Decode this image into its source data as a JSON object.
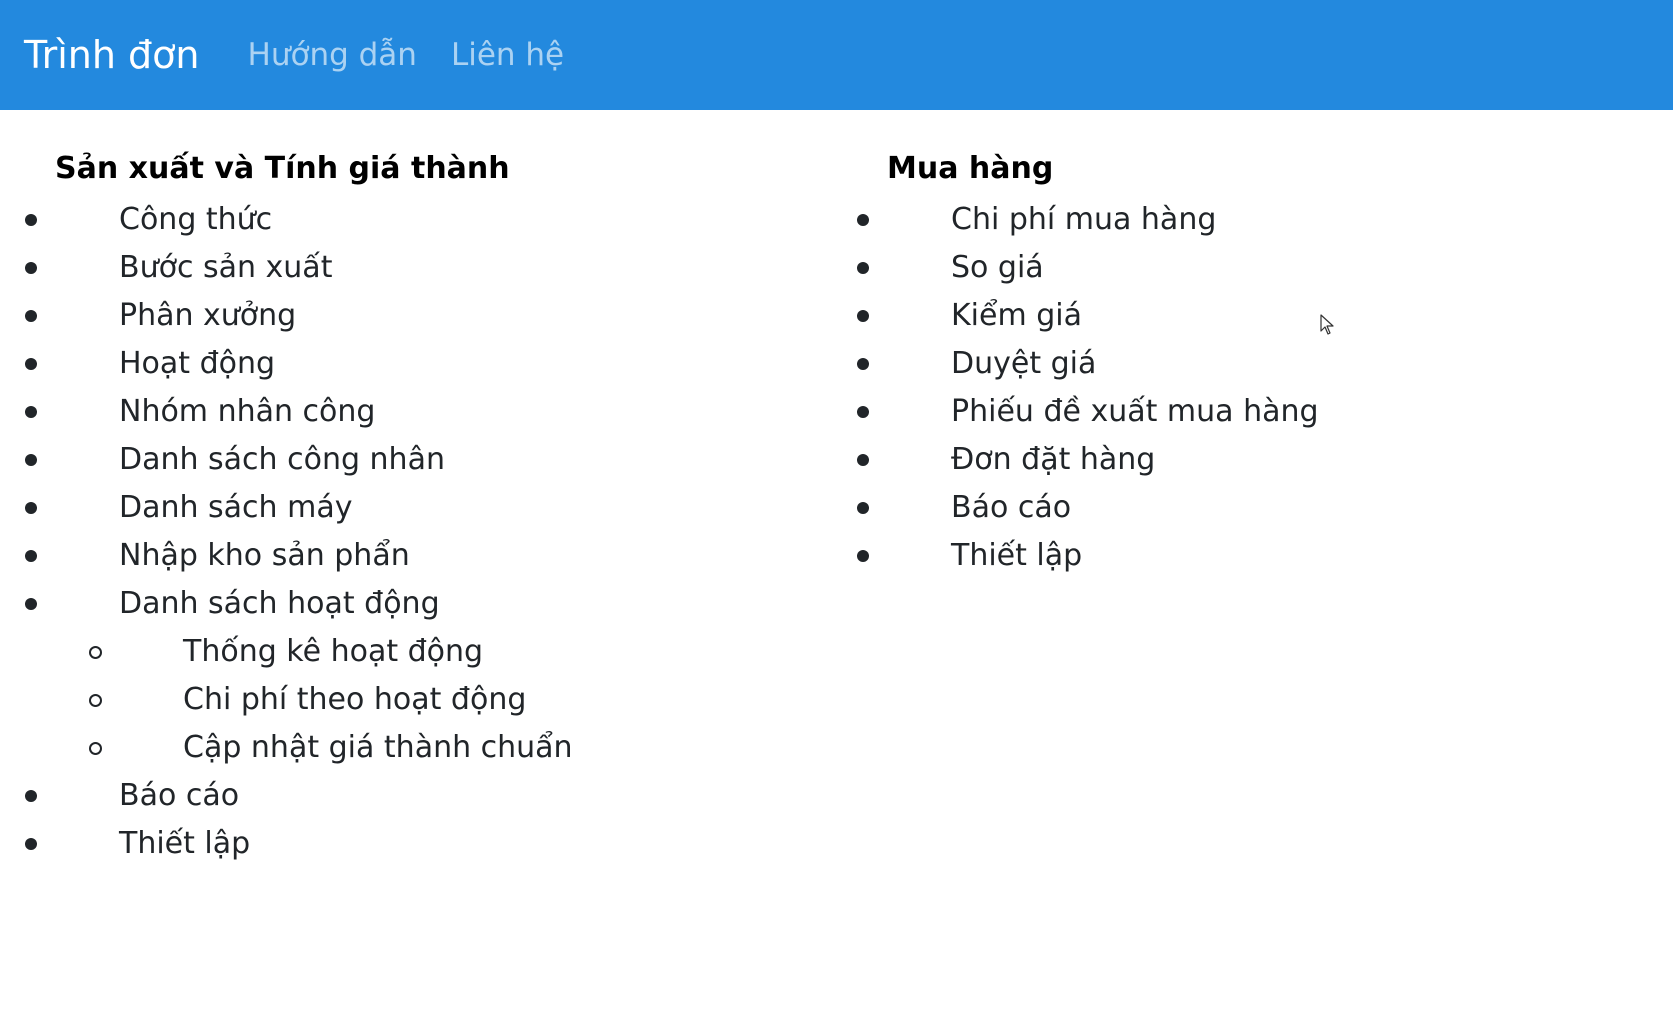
{
  "navbar": {
    "brand": "Trình đơn",
    "links": [
      "Hướng dẫn",
      "Liên hệ"
    ],
    "background_color": "#2389de"
  },
  "sections": {
    "production": {
      "title": "Sản xuất và Tính giá thành",
      "items": [
        "Công thức",
        "Bước sản xuất",
        "Phân xưởng",
        "Hoạt động",
        "Nhóm nhân công",
        "Danh sách công nhân",
        "Danh sách máy",
        "Nhập kho sản phẩn",
        "Danh sách hoạt động"
      ],
      "subitems": [
        "Thống kê hoạt động",
        "Chi phí theo hoạt động",
        "Cập nhật giá thành chuẩn"
      ],
      "items_after": [
        "Báo cáo",
        "Thiết lập"
      ]
    },
    "purchasing": {
      "title": "Mua hàng",
      "items": [
        "Chi phí mua hàng",
        "So giá",
        "Kiểm giá",
        "Duyệt giá",
        "Phiếu đề xuất mua hàng",
        "Đơn đặt hàng",
        "Báo cáo",
        "Thiết lập"
      ]
    }
  }
}
